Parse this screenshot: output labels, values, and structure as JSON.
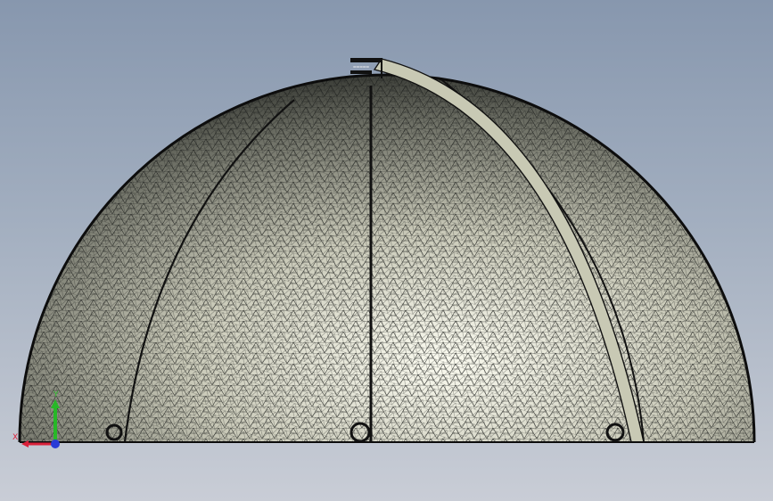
{
  "viewport": {
    "background_top": "#8797ae",
    "background_bottom": "#c9cdd6",
    "mesh_color": "#1b1d1b",
    "surface_light": "#f6f6ea",
    "surface_dark": "#4b4d45",
    "band_color": "#c8c9b4"
  },
  "triad": {
    "x_label": "X",
    "y_label": "Y",
    "x_color": "#d9213a",
    "y_color": "#27b827",
    "z_color": "#2a3bd6"
  },
  "model": {
    "name": "hemisphere-mesh",
    "tag_upper": "=====",
    "tag_lower": "=====",
    "icon": "mesh-dome"
  }
}
